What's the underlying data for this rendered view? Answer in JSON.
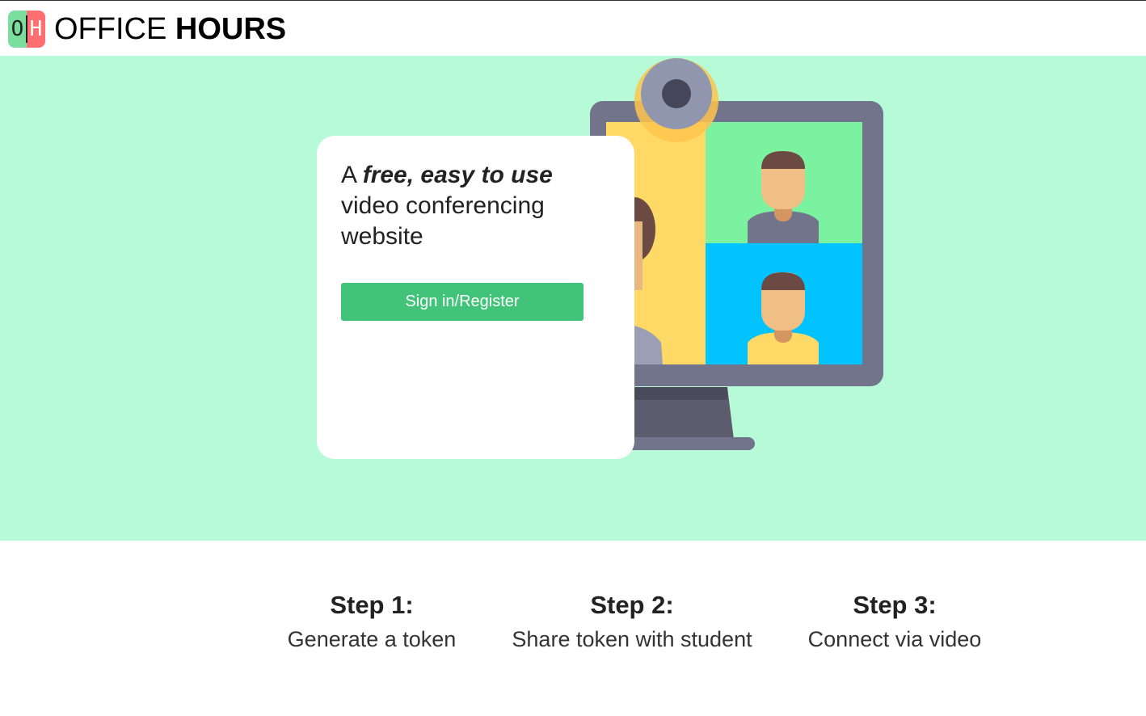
{
  "header": {
    "logo_left": "O",
    "logo_right": "H",
    "brand_light": "OFFICE ",
    "brand_bold": "HOURS"
  },
  "hero": {
    "tagline_prefix": "A ",
    "tagline_emphasis": "free, easy to use",
    "tagline_rest": " video conferencing website",
    "signin_label": "Sign in/Register"
  },
  "steps": [
    {
      "title": "Step 1:",
      "desc": "Generate a token"
    },
    {
      "title": "Step 2:",
      "desc": "Share token with student"
    },
    {
      "title": "Step 3:",
      "desc": "Connect via video"
    }
  ],
  "colors": {
    "hero_bg": "#b6fad7",
    "button": "#41c379",
    "logo_green": "#7bde9e",
    "logo_red": "#ff6f6f"
  },
  "icons": {
    "illustration": "video-call-monitor-illustration"
  }
}
